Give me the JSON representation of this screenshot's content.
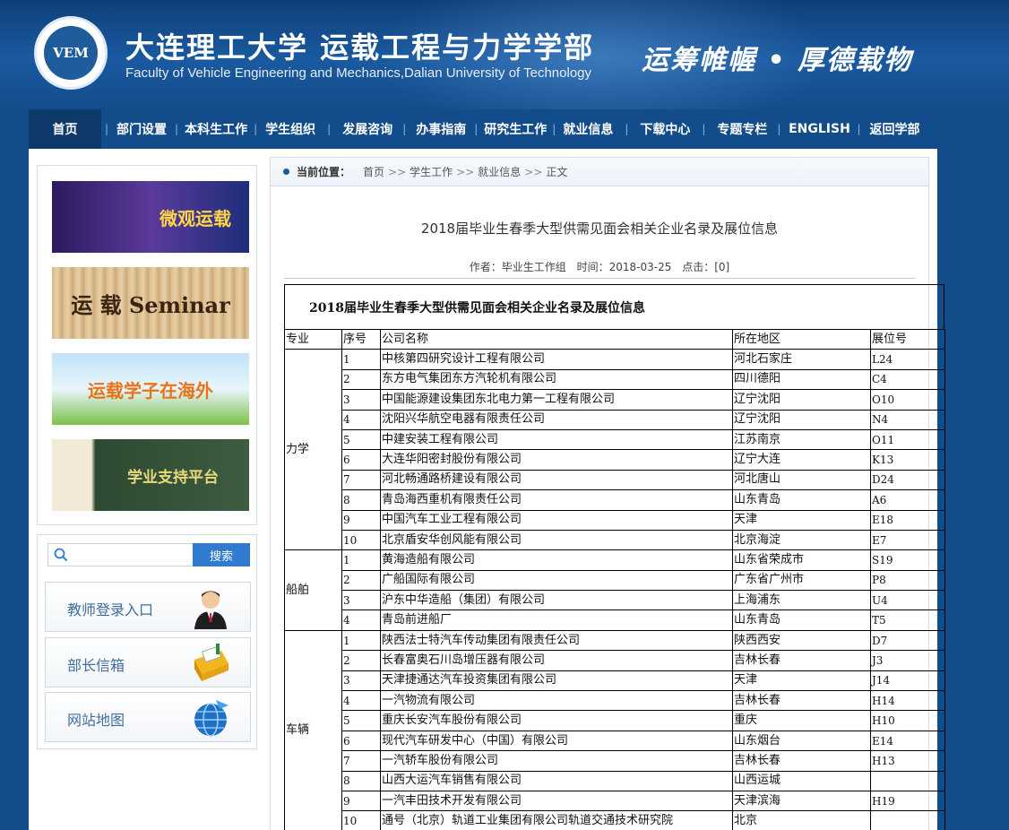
{
  "header": {
    "logo_text": "VEM",
    "title_cn": "大连理工大学  运载工程与力学学部",
    "title_en": "Faculty of Vehicle Engineering and Mechanics,Dalian University of Technology",
    "motto": "运筹帷幄 • 厚德载物"
  },
  "nav": {
    "items": [
      "首页",
      "部门设置",
      "本科生工作",
      "学生组织",
      "发展咨询",
      "办事指南",
      "研究生工作",
      "就业信息",
      "下载中心",
      "专题专栏",
      "ENGLISH",
      "返回学部"
    ],
    "active": 0
  },
  "sidebar": {
    "banners": [
      "微观运载",
      "运 载 Seminar",
      "运载学子在海外",
      "学业支持平台"
    ],
    "search": {
      "placeholder": "",
      "button": "搜索"
    },
    "quick_links": [
      "教师登录入口",
      "部长信箱",
      "网站地图"
    ]
  },
  "breadcrumb": {
    "label": "当前位置：",
    "items": [
      "首页",
      "学生工作",
      "就业信息",
      "正文"
    ],
    "separator": ">>"
  },
  "article": {
    "title": "2018届毕业生春季大型供需见面会相关企业名录及展位信息",
    "author_label": "作者：",
    "author": "毕业生工作组",
    "time_label": "时间：",
    "time": "2018-03-25",
    "clicks_label": "点击：",
    "clicks": "[0]"
  },
  "table": {
    "caption": "2018届毕业生春季大型供需见面会相关企业名录及展位信息",
    "headers": [
      "专业",
      "序号",
      "公司名称",
      "所在地区",
      "展位号"
    ],
    "groups": [
      {
        "major": "力学",
        "rows": [
          [
            "1",
            "中核第四研究设计工程有限公司",
            "河北石家庄",
            "L24"
          ],
          [
            "2",
            "东方电气集团东方汽轮机有限公司",
            "四川德阳",
            "C4"
          ],
          [
            "3",
            "中国能源建设集团东北电力第一工程有限公司",
            "辽宁沈阳",
            "O10"
          ],
          [
            "4",
            "沈阳兴华航空电器有限责任公司",
            "辽宁沈阳",
            "N4"
          ],
          [
            "5",
            "中建安装工程有限公司",
            "江苏南京",
            "O11"
          ],
          [
            "6",
            "大连华阳密封股份有限公司",
            "辽宁大连",
            "K13"
          ],
          [
            "7",
            "河北畅通路桥建设有限公司",
            "河北唐山",
            "D24"
          ],
          [
            "8",
            "青岛海西重机有限责任公司",
            "山东青岛",
            "A6"
          ],
          [
            "9",
            "中国汽车工业工程有限公司",
            "天津",
            "E18"
          ],
          [
            "10",
            "北京盾安华创风能有限公司",
            "北京海淀",
            "E7"
          ]
        ]
      },
      {
        "major": "船舶",
        "rows": [
          [
            "1",
            "黄海造船有限公司",
            "山东省荣成市",
            "S19"
          ],
          [
            "2",
            "广船国际有限公司",
            "广东省广州市",
            "P8"
          ],
          [
            "3",
            "沪东中华造船（集团）有限公司",
            "上海浦东",
            "U4"
          ],
          [
            "4",
            "青岛前进船厂",
            "山东青岛",
            "T5"
          ]
        ]
      },
      {
        "major": "车辆",
        "rows": [
          [
            "1",
            "陕西法士特汽车传动集团有限责任公司",
            "陕西西安",
            "D7"
          ],
          [
            "2",
            "长春富奥石川岛增压器有限公司",
            "吉林长春",
            "J3"
          ],
          [
            "3",
            "天津捷通达汽车投资集团有限公司",
            "天津",
            "J14"
          ],
          [
            "4",
            "一汽物流有限公司",
            "吉林长春",
            "H14"
          ],
          [
            "5",
            "重庆长安汽车股份有限公司",
            "重庆",
            "H10"
          ],
          [
            "6",
            "现代汽车研发中心（中国）有限公司",
            "山东烟台",
            "E14"
          ],
          [
            "7",
            "一汽轿车股份有限公司",
            "吉林长春",
            "H13"
          ],
          [
            "8",
            "山西大运汽车销售有限公司",
            "山西运城",
            ""
          ],
          [
            "9",
            "一汽丰田技术开发有限公司",
            "天津滨海",
            "H19"
          ],
          [
            "10",
            "通号（北京）轨道工业集团有限公司轨道交通技术研究院",
            "北京",
            ""
          ]
        ]
      }
    ]
  }
}
